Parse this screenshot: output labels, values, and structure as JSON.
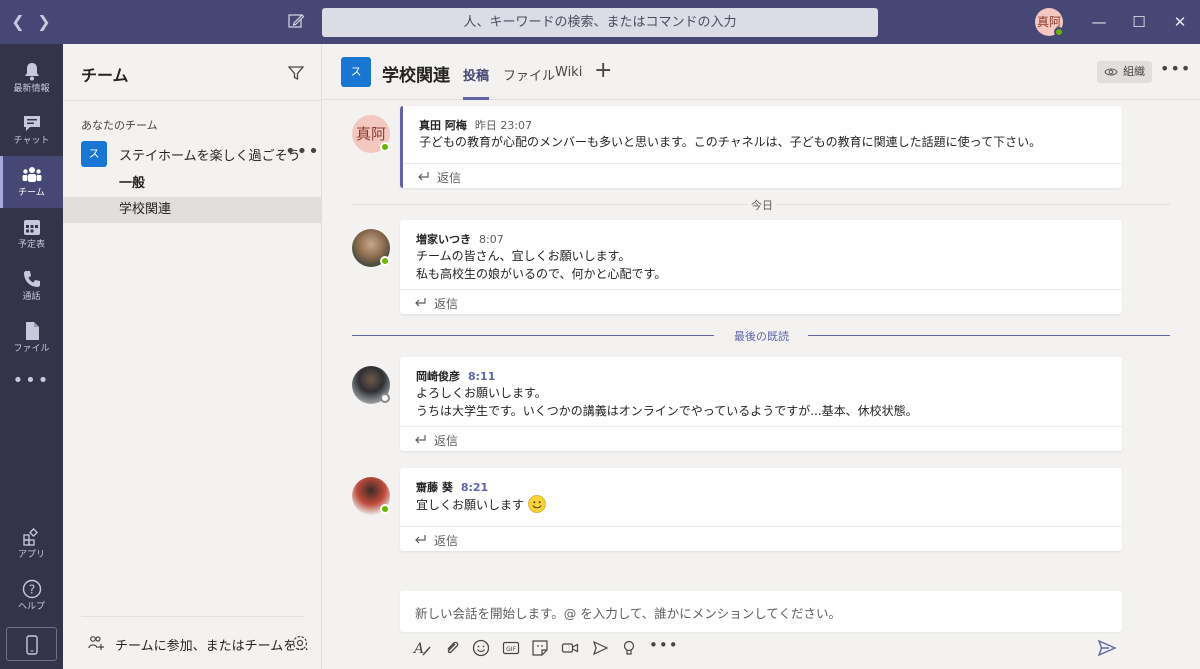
{
  "search": {
    "placeholder": "人、キーワードの検索、またはコマンドの入力"
  },
  "me": {
    "initials": "真阿"
  },
  "rail": [
    {
      "id": "activity",
      "label": "最新情報"
    },
    {
      "id": "chat",
      "label": "チャット"
    },
    {
      "id": "teams",
      "label": "チーム"
    },
    {
      "id": "calendar",
      "label": "予定表"
    },
    {
      "id": "calls",
      "label": "通話"
    },
    {
      "id": "files",
      "label": "ファイル"
    },
    {
      "id": "apps",
      "label": "アプリ"
    },
    {
      "id": "help",
      "label": "ヘルプ"
    }
  ],
  "leftpane": {
    "title": "チーム",
    "section": "あなたのチーム",
    "team": {
      "initial": "ス",
      "name": "ステイホームを楽しく過ごそう"
    },
    "channels": [
      "一般",
      "学校関連"
    ],
    "join": "チームに参加、またはチームを..."
  },
  "channel": {
    "initial": "ス",
    "name": "学校関連",
    "tabs": [
      "投稿",
      "ファイル",
      "Wiki"
    ],
    "org": "組織"
  },
  "messages": [
    {
      "avatar": "真阿",
      "author": "真田 阿梅",
      "time": "昨日 23:07",
      "lines": [
        "子どもの教育が心配のメンバーも多いと思います。このチャネルは、子どもの教育に関連した話題に使って下さい。"
      ],
      "reply": "返信"
    },
    {
      "author": "増家いつき",
      "time": "8:07",
      "lines": [
        "チームの皆さん、宜しくお願いします。",
        "私も高校生の娘がいるので、何かと心配です。"
      ],
      "reply": "返信"
    },
    {
      "author": "岡崎俊彦",
      "time": "8:11",
      "lines": [
        "よろしくお願いします。",
        "うちは大学生です。いくつかの講義はオンラインでやっているようですが...基本、休校状態。"
      ],
      "reply": "返信"
    },
    {
      "author": "齋藤 葵",
      "time": "8:21",
      "lines": [
        "宜しくお願いします"
      ],
      "reply": "返信"
    }
  ],
  "dividers": {
    "today": "今日",
    "last_read": "最後の既読"
  },
  "composer": {
    "placeholder": "新しい会話を開始します。@ を入力して、誰かにメンションしてください。"
  },
  "colors": {
    "brand": "#464775",
    "accent": "#6264a7",
    "rail": "#33344a",
    "presence": "#6bb700"
  }
}
